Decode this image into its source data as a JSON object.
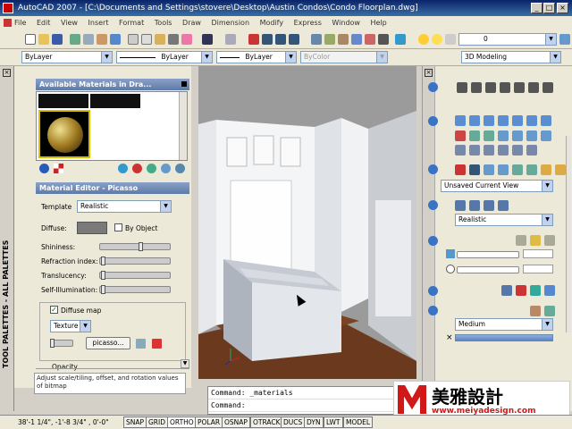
{
  "window": {
    "title": "AutoCAD 2007 - [C:\\Documents and Settings\\stovere\\Desktop\\Austin Condos\\Condo Floorplan.dwg]",
    "min": "_",
    "max": "□",
    "close": "×"
  },
  "menu": [
    "File",
    "Edit",
    "View",
    "Insert",
    "Format",
    "Tools",
    "Draw",
    "Dimension",
    "Modify",
    "Express",
    "Window",
    "Help"
  ],
  "toolbar": {
    "layer_value": "0",
    "workspace": "3D Modeling"
  },
  "properties": {
    "color": "ByLayer",
    "linetype": "ByLayer",
    "lineweight": "ByLayer",
    "plotstyle": "ByColor"
  },
  "palette": {
    "side_title": "TOOL PALETTES - ALL PALETTES",
    "materials_header": "Available Materials in Dra...",
    "editor_header": "Material Editor - Picasso",
    "template_label": "Template",
    "template_value": "Realistic",
    "diffuse_label": "Diffuse:",
    "by_object": "By Object",
    "sliders": [
      {
        "label": "Shininess:",
        "value": 0.6
      },
      {
        "label": "Refraction index:",
        "value": 0.02
      },
      {
        "label": "Translucency:",
        "value": 0.02
      },
      {
        "label": "Self-Illumination:",
        "value": 0.02
      }
    ],
    "diffuse_map": "Diffuse map",
    "map_type": "Texture M",
    "map_file": "picasso...",
    "opacity": "Opacity",
    "help_text": "Adjust scale/tiling, offset, and rotation values of bitmap"
  },
  "dashboard": {
    "view_combo": "Unsaved Current View",
    "visual_style": "Realistic",
    "quality": "Medium"
  },
  "command": {
    "line1": "Command: _materials",
    "line2": "Command:"
  },
  "status": {
    "coords": "38'-1 1/4\",  -1'-8 3/4\" , 0'-0\"",
    "buttons": [
      "SNAP",
      "GRID",
      "ORTHO",
      "POLAR",
      "OSNAP",
      "OTRACK",
      "DUCS",
      "DYN",
      "LWT",
      "MODEL"
    ]
  },
  "logo": {
    "brand": "美雅設計",
    "url": "www.meiyadesign.com"
  },
  "colors": {
    "title_bar": "#0a246a",
    "panel_header": "#5d7aa8",
    "floor": "#6b3a1e",
    "logo_red": "#d01818"
  }
}
